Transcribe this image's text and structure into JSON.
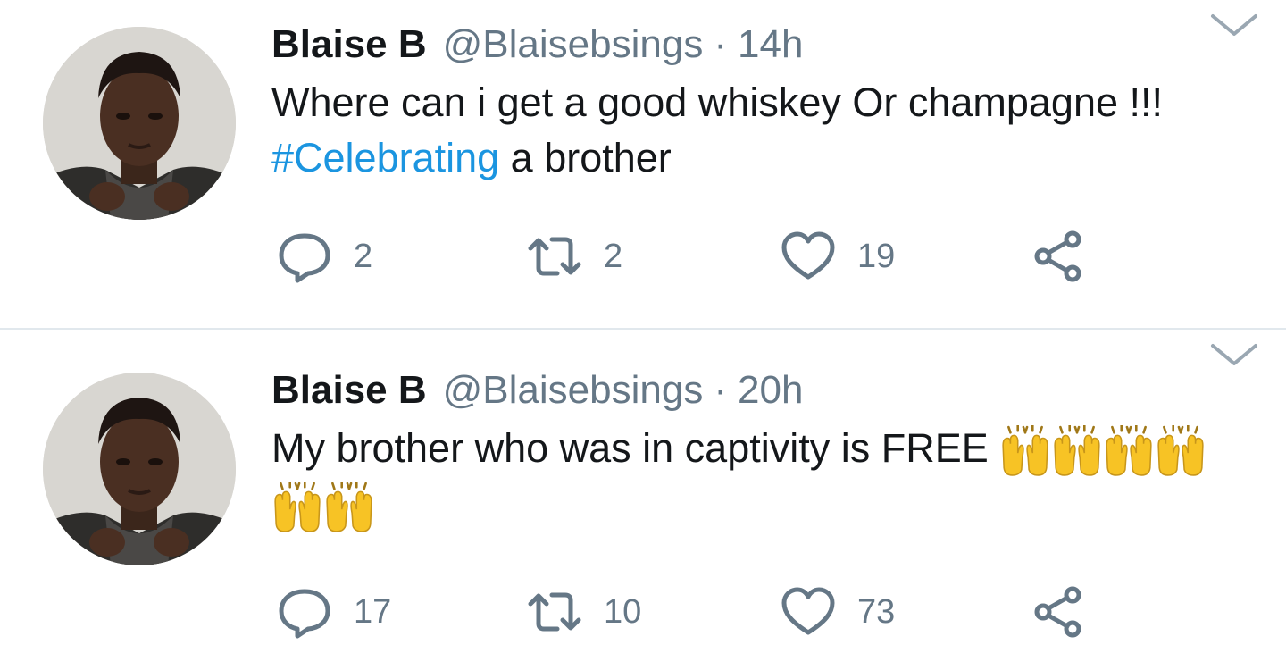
{
  "tweets": [
    {
      "name": "Blaise B",
      "handle": "@Blaisebsings",
      "separator": "·",
      "time": "14h",
      "text_part1": "Where can i get a good whiskey Or champagne !!!\n",
      "hashtag": "#Celebrating",
      "text_part2": " a brother",
      "emoji_count": 0,
      "replies": "2",
      "retweets": "2",
      "likes": "19"
    },
    {
      "name": "Blaise B",
      "handle": "@Blaisebsings",
      "separator": "·",
      "time": "20h",
      "text_part1": "My brother who was in captivity is FREE ",
      "hashtag": "",
      "text_part2": "",
      "emoji": "raising-hands",
      "emoji_count": 6,
      "replies": "17",
      "retweets": "10",
      "likes": "73"
    }
  ],
  "colors": {
    "text": "#14171a",
    "secondary": "#657786",
    "hashtag": "#1b95e0",
    "divider": "#e1e8ed",
    "emoji": "#f7c325"
  },
  "icons": {
    "reply": "reply-bubble-icon",
    "retweet": "retweet-icon",
    "like": "heart-icon",
    "share": "share-icon",
    "menu": "chevron-down-icon"
  }
}
